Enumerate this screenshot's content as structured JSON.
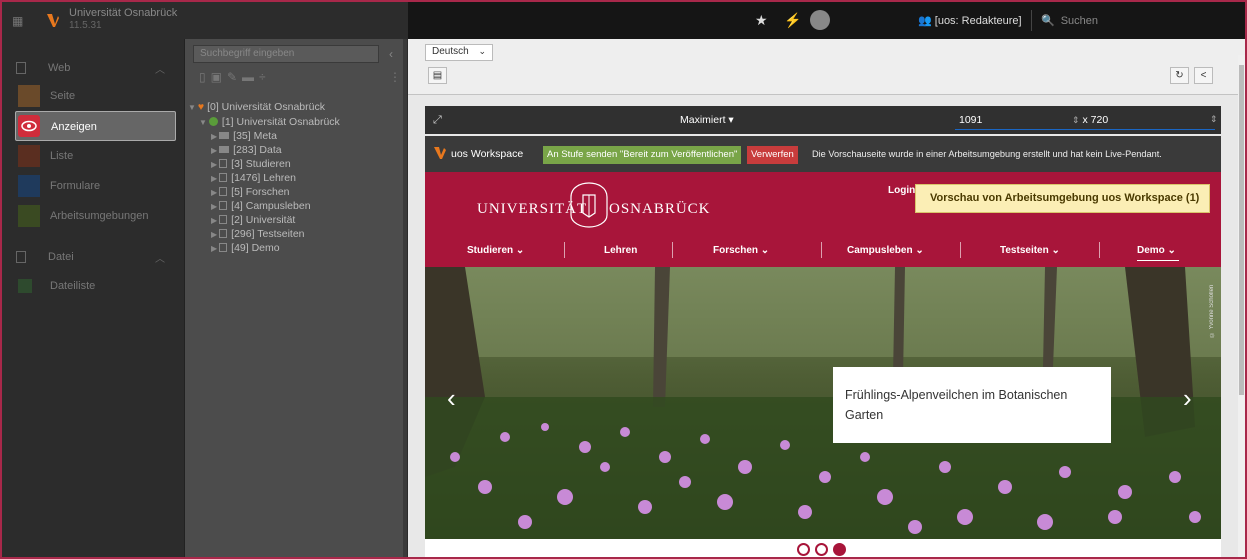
{
  "topbar": {
    "site_name": "Universität Osnabrück",
    "site_version": "11.5.31",
    "user_group": "[uos: Redakteure]",
    "search_placeholder": "Suchen"
  },
  "module_menu": {
    "groups": [
      {
        "label": "Web"
      },
      {
        "label": "Datei"
      }
    ],
    "items": [
      {
        "label": "Seite",
        "color": "#e07b1f"
      },
      {
        "label": "Anzeigen",
        "color": "#d02c3b"
      },
      {
        "label": "Liste",
        "color": "#c84a1e"
      },
      {
        "label": "Formulare",
        "color": "#1e5bb0"
      },
      {
        "label": "Arbeitsumgebungen",
        "color": "#5a9b2a"
      },
      {
        "label": "Dateiliste",
        "color": "#4aa04a"
      }
    ]
  },
  "page_tree": {
    "search_placeholder": "Suchbegriff eingeben",
    "nodes": [
      {
        "label": "[0] Universität Osnabrück"
      },
      {
        "label": "[1] Universität Osnabrück"
      },
      {
        "label": "[35] Meta"
      },
      {
        "label": "[283] Data"
      },
      {
        "label": "[3] Studieren"
      },
      {
        "label": "[1476] Lehren"
      },
      {
        "label": "[5] Forschen"
      },
      {
        "label": "[4] Campusleben"
      },
      {
        "label": "[2] Universität"
      },
      {
        "label": "[296] Testseiten"
      },
      {
        "label": "[49] Demo"
      }
    ]
  },
  "docheader": {
    "language": "Deutsch"
  },
  "viewport": {
    "preset": "Maximiert",
    "width": "1091",
    "height": "x 720"
  },
  "workspace": {
    "name": "uos Workspace",
    "send_label": "An Stufe senden \"Bereit zum Veröffentlichen\"",
    "discard_label": "Verwerfen",
    "info": "Die Vorschauseite wurde in einer Arbeitsumgebung erstellt und hat kein Live-Pendant."
  },
  "website": {
    "logo_left": "UNIVERSITÄT",
    "logo_right": "OSNABRÜCK",
    "login": "Login",
    "preview_badge": "Vorschau von Arbeitsumgebung uos Workspace (1)",
    "nav": [
      {
        "label": "Studieren ⌄"
      },
      {
        "label": "Lehren"
      },
      {
        "label": "Forschen ⌄"
      },
      {
        "label": "Campusleben ⌄"
      },
      {
        "label": "Testseiten ⌄"
      },
      {
        "label": "Demo ⌄"
      }
    ],
    "slide_caption": "Frühlings-Alpenveilchen im Botanischen Garten",
    "photo_credit": "© Yvonne Schollen",
    "slide_count": 3,
    "active_slide": 3
  }
}
